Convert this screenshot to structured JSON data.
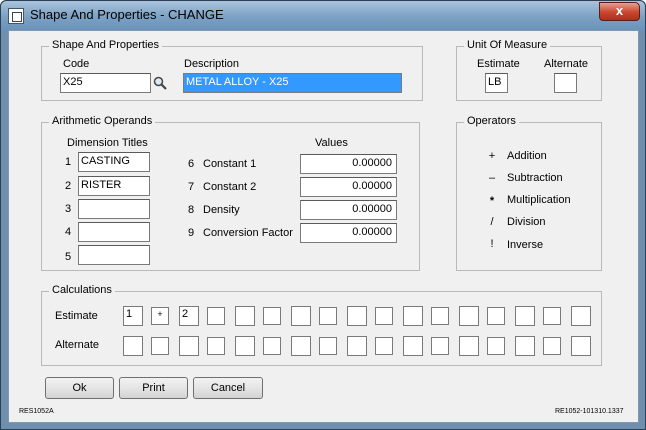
{
  "window": {
    "title": "Shape And Properties - CHANGE",
    "close_label": "x"
  },
  "shape": {
    "legend": "Shape And Properties",
    "code_label": "Code",
    "code_value": "X25",
    "description_label": "Description",
    "description_value": "METAL ALLOY - X25"
  },
  "uom": {
    "legend": "Unit Of Measure",
    "estimate_label": "Estimate",
    "estimate_value": "LB",
    "alternate_label": "Alternate",
    "alternate_value": ""
  },
  "operands": {
    "legend": "Arithmetic Operands",
    "dimension_titles_label": "Dimension Titles",
    "values_label": "Values",
    "dimensions": [
      {
        "num": "1",
        "value": "CASTING"
      },
      {
        "num": "2",
        "value": "RISTER"
      },
      {
        "num": "3",
        "value": ""
      },
      {
        "num": "4",
        "value": ""
      },
      {
        "num": "5",
        "value": ""
      }
    ],
    "constants": [
      {
        "num": "6",
        "label": "Constant 1",
        "value": "0.00000"
      },
      {
        "num": "7",
        "label": "Constant 2",
        "value": "0.00000"
      },
      {
        "num": "8",
        "label": "Density",
        "value": "0.00000"
      },
      {
        "num": "9",
        "label": "Conversion Factor",
        "value": "0.00000"
      }
    ]
  },
  "operators": {
    "legend": "Operators",
    "items": [
      {
        "symbol": "+",
        "label": "Addition",
        "icon": "plus-icon"
      },
      {
        "symbol": "–",
        "label": "Subtraction",
        "icon": "minus-icon"
      },
      {
        "symbol": "*",
        "label": "Multiplication",
        "icon": "asterisk-icon"
      },
      {
        "symbol": "/",
        "label": "Division",
        "icon": "slash-icon"
      },
      {
        "symbol": "!",
        "label": "Inverse",
        "icon": "exclamation-icon"
      }
    ]
  },
  "calculations": {
    "legend": "Calculations",
    "estimate_label": "Estimate",
    "alternate_label": "Alternate",
    "estimate_cells": [
      "1",
      "+",
      "2",
      "",
      "",
      "",
      "",
      "",
      "",
      "",
      "",
      "",
      "",
      "",
      "",
      "",
      ""
    ],
    "alternate_cells": [
      "",
      "",
      "",
      "",
      "",
      "",
      "",
      "",
      "",
      "",
      "",
      "",
      "",
      "",
      "",
      "",
      ""
    ]
  },
  "buttons": {
    "ok": "Ok",
    "print": "Print",
    "cancel": "Cancel"
  },
  "footer": {
    "left": "RES1052A",
    "right": "RE1052-101310.1337"
  }
}
